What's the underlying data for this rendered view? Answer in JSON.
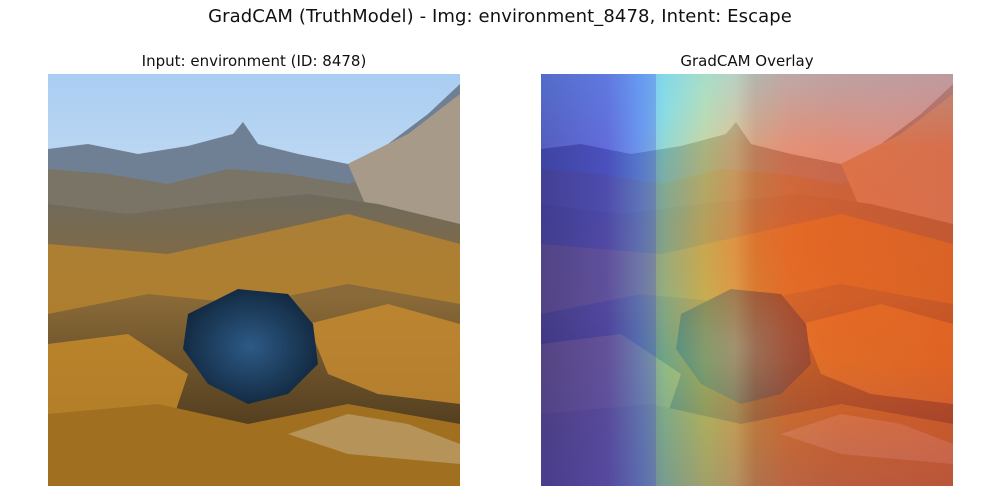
{
  "figure": {
    "title": "GradCAM (TruthModel) - Img: environment_8478, Intent: Escape"
  },
  "panels": [
    {
      "title": "Input: environment (ID: 8478)"
    },
    {
      "title": "GradCAM Overlay"
    }
  ],
  "colors": {
    "sky": "#b8d6f0",
    "mountain": "#5a6a80",
    "forest_orange": "#c88a2a",
    "lake": "#1d3a58",
    "heatmap_hot": "#ff5a20",
    "heatmap_cold": "#3f3fd8"
  }
}
